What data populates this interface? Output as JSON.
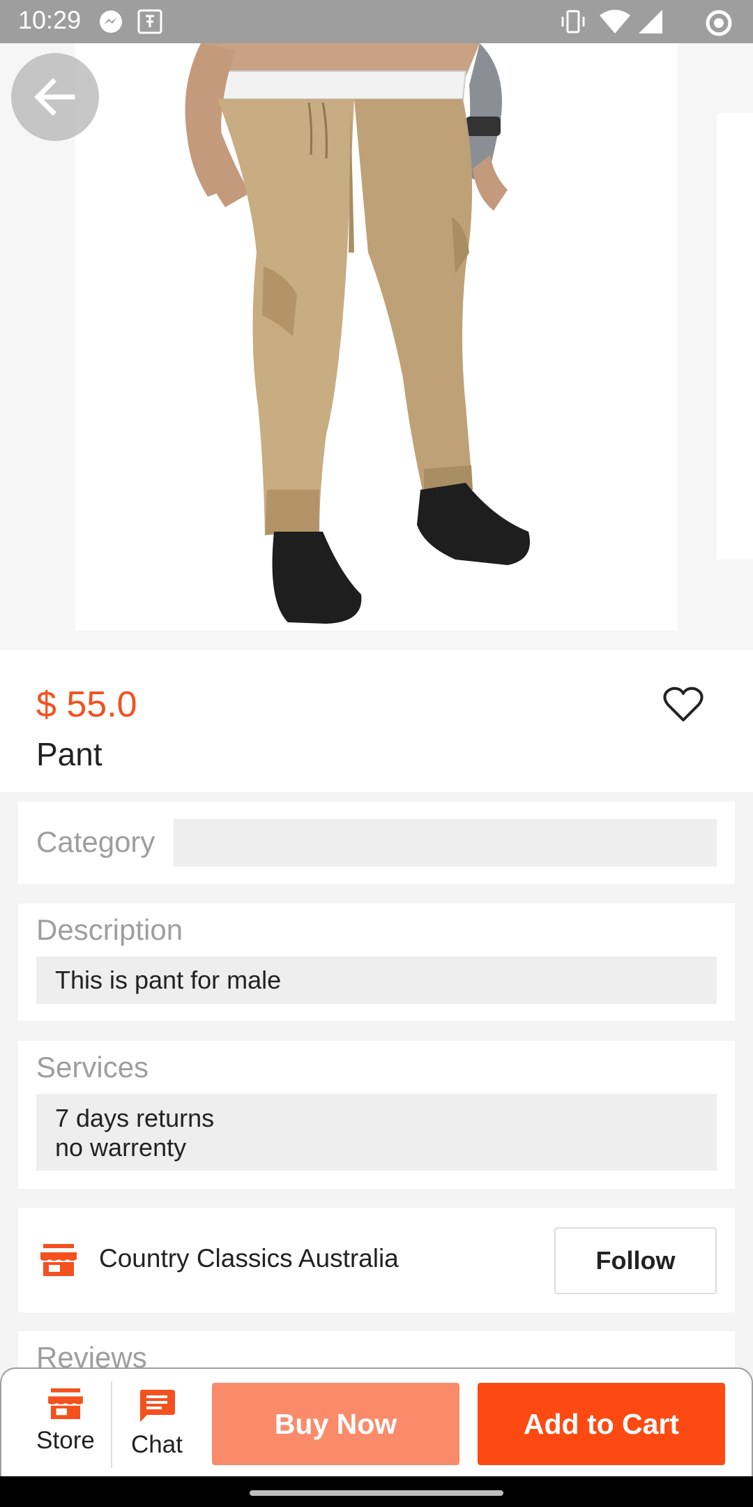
{
  "status_bar": {
    "time": "10:29",
    "left_icons": [
      "messenger-icon",
      "shop-notification-icon"
    ],
    "right_icons": [
      "vibrate-icon",
      "wifi-icon",
      "signal-icon",
      "data-saver-icon"
    ]
  },
  "product": {
    "image": "khaki-jogger-pants-photo",
    "price": "$ 55.0",
    "title": "Pant",
    "favorite_icon": "heart-outline-icon",
    "colors": {
      "price": "#f4511e"
    }
  },
  "sections": {
    "category_label": "Category",
    "category_value": "",
    "description_label": "Description",
    "description_value": "This is pant for male",
    "services_label": "Services",
    "services_line1": "7 days returns",
    "services_line2": "no warrenty",
    "reviews_label": "Reviews"
  },
  "store": {
    "icon": "storefront-icon",
    "name": "Country Classics Australia",
    "follow_label": "Follow"
  },
  "action_bar": {
    "store_label": "Store",
    "chat_label": "Chat",
    "buy_now_label": "Buy Now",
    "add_to_cart_label": "Add to Cart",
    "colors": {
      "buy_now": "#f98b6b",
      "add_to_cart": "#fc4a12",
      "icon": "#f4511e"
    }
  }
}
